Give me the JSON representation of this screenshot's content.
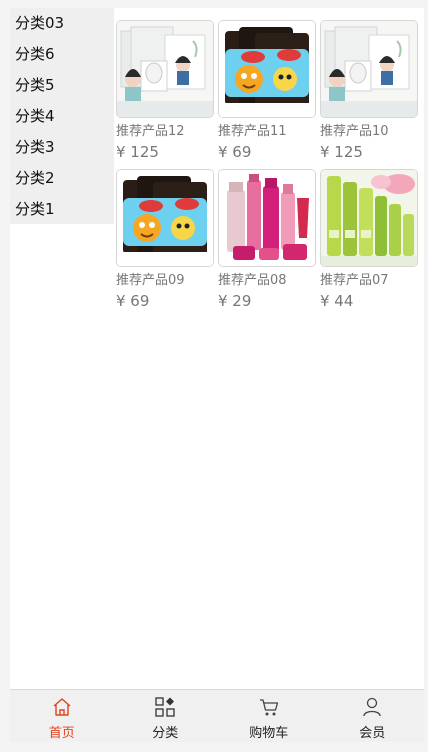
{
  "sidebar": {
    "items": [
      {
        "label": "分类03"
      },
      {
        "label": "分类6"
      },
      {
        "label": "分类5"
      },
      {
        "label": "分类4"
      },
      {
        "label": "分类3"
      },
      {
        "label": "分类2"
      },
      {
        "label": "分类1"
      }
    ]
  },
  "products": [
    {
      "name": "推荐产品12",
      "price": "¥ 125",
      "image": "face-mask-box"
    },
    {
      "name": "推荐产品11",
      "price": "¥ 69",
      "image": "cartoon-mask-pack"
    },
    {
      "name": "推荐产品10",
      "price": "¥ 125",
      "image": "face-mask-box"
    },
    {
      "name": "推荐产品09",
      "price": "¥ 69",
      "image": "cartoon-mask-pack"
    },
    {
      "name": "推荐产品08",
      "price": "¥ 29",
      "image": "pink-cosmetics-set"
    },
    {
      "name": "推荐产品07",
      "price": "¥ 44",
      "image": "green-skincare-set"
    }
  ],
  "tabbar": {
    "items": [
      {
        "label": "首页",
        "icon": "home-icon",
        "active": true
      },
      {
        "label": "分类",
        "icon": "category-icon",
        "active": false
      },
      {
        "label": "购物车",
        "icon": "cart-icon",
        "active": false
      },
      {
        "label": "会员",
        "icon": "user-icon",
        "active": false
      }
    ],
    "active_color": "#e2431f"
  }
}
